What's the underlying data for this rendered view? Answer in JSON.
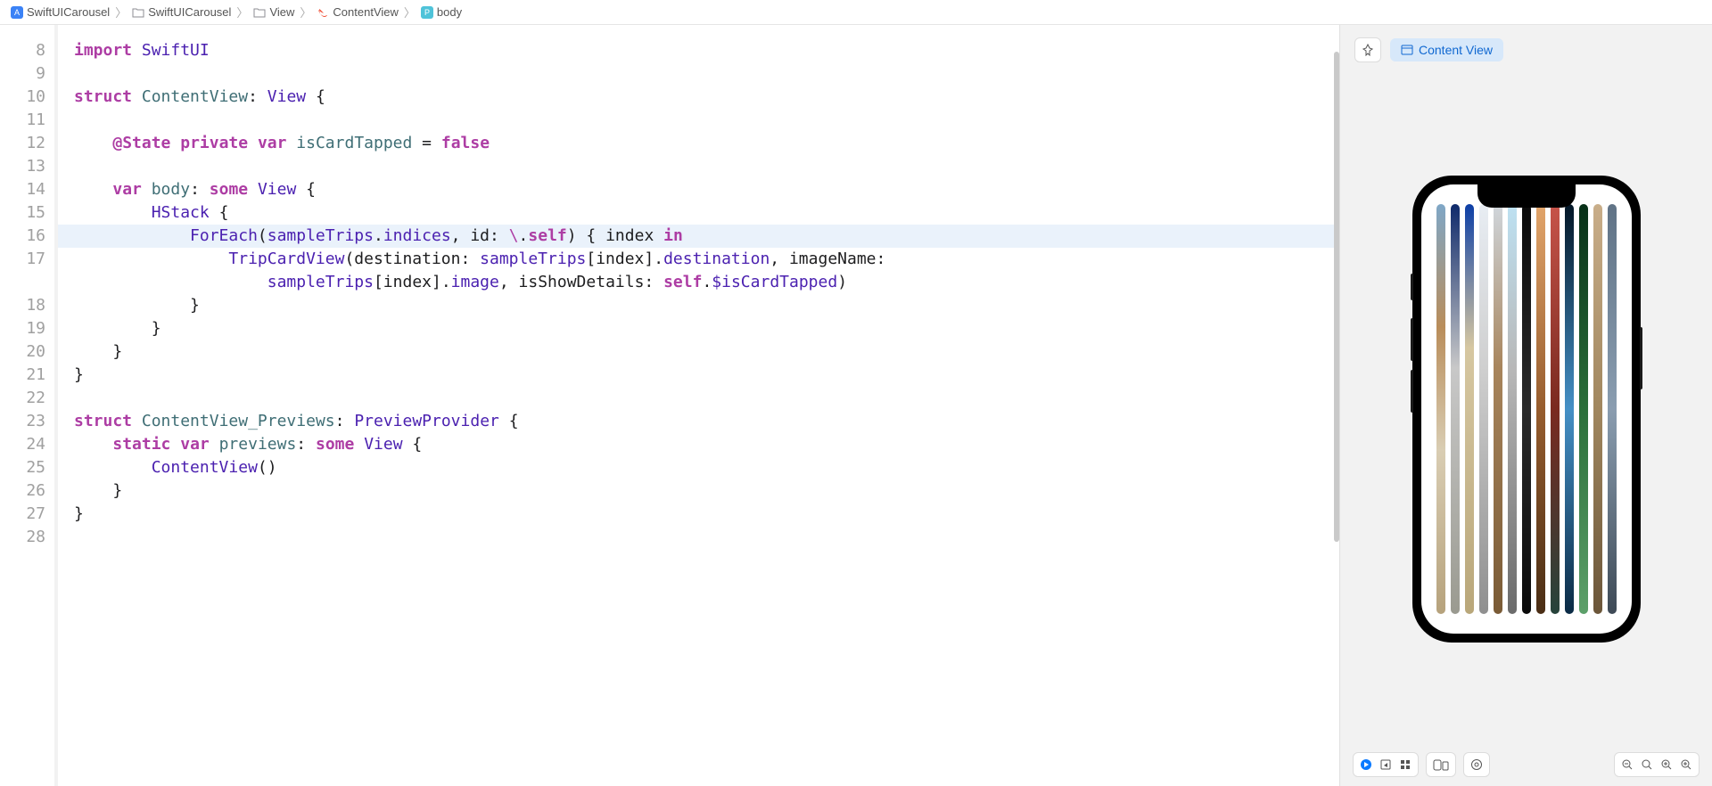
{
  "breadcrumb": [
    {
      "icon": "app-icon",
      "label": "SwiftUICarousel"
    },
    {
      "icon": "folder-icon",
      "label": "SwiftUICarousel"
    },
    {
      "icon": "folder-icon",
      "label": "View"
    },
    {
      "icon": "swift-icon",
      "label": "ContentView"
    },
    {
      "icon": "property-icon",
      "label": "body"
    }
  ],
  "editor": {
    "lines": [
      "8",
      "9",
      "10",
      "11",
      "12",
      "13",
      "14",
      "15",
      "16",
      "17",
      "",
      "18",
      "19",
      "20",
      "21",
      "22",
      "23",
      "24",
      "25",
      "26",
      "27",
      "28"
    ],
    "highlighted_line": "16",
    "code": {
      "l8": [
        [
          "kw",
          "import"
        ],
        [
          "op",
          " "
        ],
        [
          "ident",
          "SwiftUI"
        ]
      ],
      "l9": [],
      "l10": [
        [
          "kw",
          "struct"
        ],
        [
          "op",
          " "
        ],
        [
          "type",
          "ContentView"
        ],
        [
          "op",
          ": "
        ],
        [
          "ident",
          "View"
        ],
        [
          "op",
          " {"
        ]
      ],
      "l11": [],
      "l12": [
        [
          "op",
          "    "
        ],
        [
          "kw",
          "@State"
        ],
        [
          "op",
          " "
        ],
        [
          "kw",
          "private"
        ],
        [
          "op",
          " "
        ],
        [
          "kw",
          "var"
        ],
        [
          "op",
          " "
        ],
        [
          "type",
          "isCardTapped"
        ],
        [
          "op",
          " = "
        ],
        [
          "kw",
          "false"
        ]
      ],
      "l13": [],
      "l14": [
        [
          "op",
          "    "
        ],
        [
          "kw",
          "var"
        ],
        [
          "op",
          " "
        ],
        [
          "type",
          "body"
        ],
        [
          "op",
          ": "
        ],
        [
          "kw",
          "some"
        ],
        [
          "op",
          " "
        ],
        [
          "ident",
          "View"
        ],
        [
          "op",
          " {"
        ]
      ],
      "l15": [
        [
          "op",
          "        "
        ],
        [
          "ident",
          "HStack"
        ],
        [
          "op",
          " {"
        ]
      ],
      "l16": [
        [
          "op",
          "            "
        ],
        [
          "ident",
          "ForEach"
        ],
        [
          "op",
          "("
        ],
        [
          "ident",
          "sampleTrips"
        ],
        [
          "op",
          "."
        ],
        [
          "ident",
          "indices"
        ],
        [
          "op",
          ", id: "
        ],
        [
          "escape",
          "\\"
        ],
        [
          "op",
          "."
        ],
        [
          "kw",
          "self"
        ],
        [
          "op",
          ") { index "
        ],
        [
          "kw",
          "in"
        ]
      ],
      "l17": [
        [
          "op",
          "                "
        ],
        [
          "ident",
          "TripCardView"
        ],
        [
          "op",
          "(destination: "
        ],
        [
          "ident",
          "sampleTrips"
        ],
        [
          "op",
          "[index]."
        ],
        [
          "ident",
          "destination"
        ],
        [
          "op",
          ", imageName: "
        ]
      ],
      "l17b": [
        [
          "op",
          "                    "
        ],
        [
          "ident",
          "sampleTrips"
        ],
        [
          "op",
          "[index]."
        ],
        [
          "ident",
          "image"
        ],
        [
          "op",
          ", isShowDetails: "
        ],
        [
          "kw",
          "self"
        ],
        [
          "op",
          "."
        ],
        [
          "ident",
          "$isCardTapped"
        ],
        [
          "op",
          ")"
        ]
      ],
      "l18": [
        [
          "op",
          "            }"
        ]
      ],
      "l19": [
        [
          "op",
          "        }"
        ]
      ],
      "l20": [
        [
          "op",
          "    }"
        ]
      ],
      "l21": [
        [
          "op",
          "}"
        ]
      ],
      "l22": [],
      "l23": [
        [
          "kw",
          "struct"
        ],
        [
          "op",
          " "
        ],
        [
          "type",
          "ContentView_Previews"
        ],
        [
          "op",
          ": "
        ],
        [
          "ident",
          "PreviewProvider"
        ],
        [
          "op",
          " {"
        ]
      ],
      "l24": [
        [
          "op",
          "    "
        ],
        [
          "kw",
          "static"
        ],
        [
          "op",
          " "
        ],
        [
          "kw",
          "var"
        ],
        [
          "op",
          " "
        ],
        [
          "type",
          "previews"
        ],
        [
          "op",
          ": "
        ],
        [
          "kw",
          "some"
        ],
        [
          "op",
          " "
        ],
        [
          "ident",
          "View"
        ],
        [
          "op",
          " {"
        ]
      ],
      "l25": [
        [
          "op",
          "        "
        ],
        [
          "ident",
          "ContentView"
        ],
        [
          "op",
          "()"
        ]
      ],
      "l26": [
        [
          "op",
          "    }"
        ]
      ],
      "l27": [
        [
          "op",
          "}"
        ]
      ],
      "l28": []
    }
  },
  "preview": {
    "pill_label": "Content View",
    "strip_colors": [
      "linear-gradient(#7fa7c7,#b98d5a 30%,#d9cdb3 60%,#b6a27c)",
      "linear-gradient(#0f2a6b,#c8c8c8 40%,#9a9a90)",
      "linear-gradient(#0d3fa6,#d6c7a1 35%,#b9a77a)",
      "linear-gradient(#e8edf3,#cfcfcf 40%,#8f8f8f)",
      "linear-gradient(#d0d6dc,#a8855c 40%,#7a5b36)",
      "linear-gradient(#bde1f2,#b8b8b8 40%,#6b6b6b)",
      "linear-gradient(#0a0a0a,#2a2a2a 50%,#0a0a0a)",
      "linear-gradient(#e2a56b,#975d2e 50%,#4a2e15)",
      "linear-gradient(#c7544a,#7a2a20 50%,#26433b)",
      "linear-gradient(#031626,#4590c6 50%,#0b2b45)",
      "linear-gradient(#083018,#2b6f3a 50%,#5da06a)",
      "linear-gradient(#c9ae8a,#a1875f 50%,#6b563a)",
      "linear-gradient(#607386,#8a9db0 50%,#3e4a56)"
    ]
  }
}
